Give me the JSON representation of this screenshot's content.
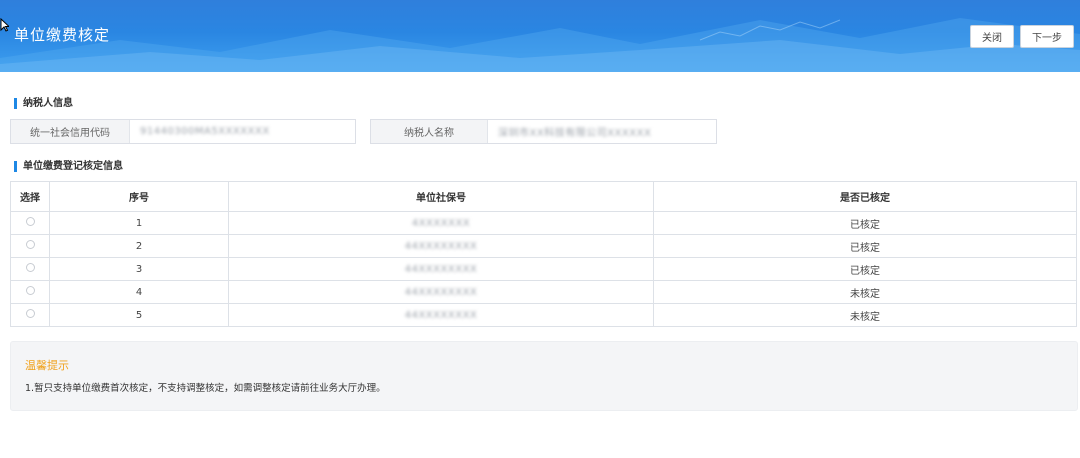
{
  "header": {
    "title": "单位缴费核定",
    "close_label": "关闭",
    "next_label": "下一步"
  },
  "taxpayer": {
    "section_title": "纳税人信息",
    "credit_code_label": "统一社会信用代码",
    "credit_code_value": "91440300MA5XXXXXXX",
    "name_label": "纳税人名称",
    "name_value": "深圳市XX科技有限公司XXXXXX"
  },
  "registration": {
    "section_title": "单位缴费登记核定信息",
    "columns": [
      "选择",
      "序号",
      "单位社保号",
      "是否已核定"
    ],
    "rows": [
      {
        "index": "1",
        "social_no": "4XXXXXXX",
        "status": "已核定"
      },
      {
        "index": "2",
        "social_no": "44XXXXXXXX",
        "status": "已核定"
      },
      {
        "index": "3",
        "social_no": "44XXXXXXXX",
        "status": "已核定"
      },
      {
        "index": "4",
        "social_no": "44XXXXXXXX",
        "status": "未核定"
      },
      {
        "index": "5",
        "social_no": "44XXXXXXXX",
        "status": "未核定"
      }
    ]
  },
  "tip": {
    "title": "温馨提示",
    "text": "1.暂只支持单位缴费首次核定，不支持调整核定，如需调整核定请前往业务大厅办理。"
  },
  "icons": {
    "cursor": "mouse-pointer-icon",
    "radio": "radio-empty-icon"
  },
  "colors": {
    "header_blue": "#2a86e2",
    "accent_blue": "#1e88e5",
    "tip_orange": "#f0a21d"
  }
}
